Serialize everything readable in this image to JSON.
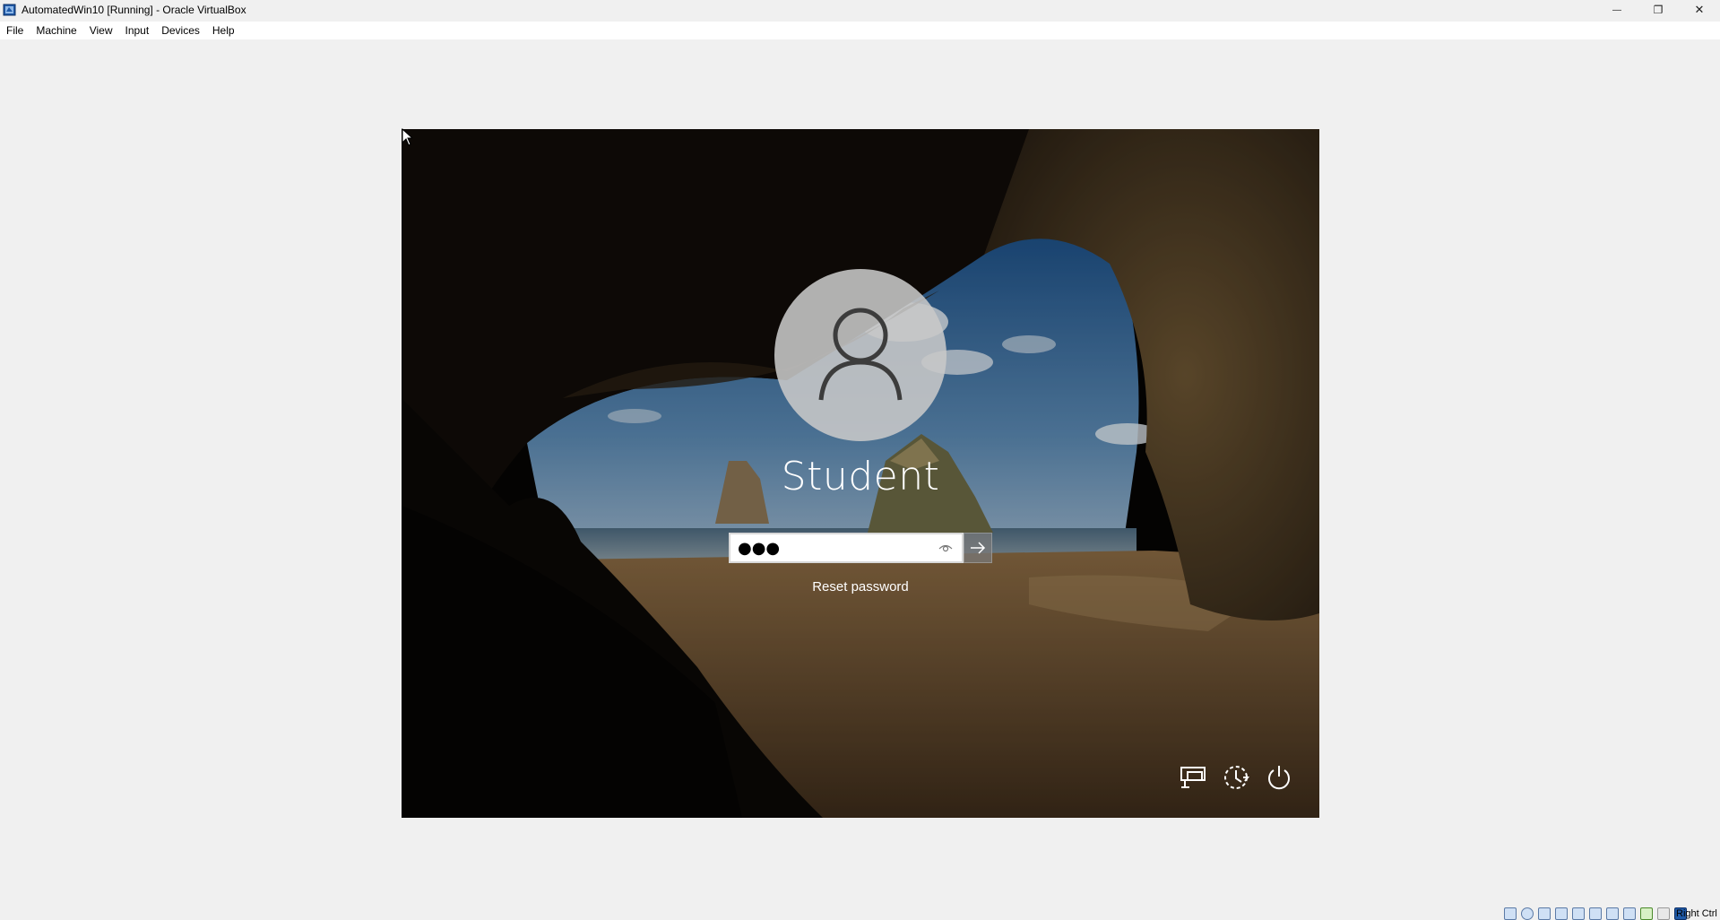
{
  "window": {
    "title": "AutomatedWin10 [Running] - Oracle VirtualBox",
    "controls": {
      "minimize": "—",
      "maximize": "❐",
      "close": "✕"
    }
  },
  "menu": {
    "items": [
      {
        "label": "File"
      },
      {
        "label": "Machine"
      },
      {
        "label": "View"
      },
      {
        "label": "Input"
      },
      {
        "label": "Devices"
      },
      {
        "label": "Help"
      }
    ]
  },
  "login": {
    "username": "Student",
    "password_value": "●●●",
    "reset_link": "Reset password"
  },
  "system_icons": [
    "network-icon",
    "accessibility-icon",
    "power-icon"
  ],
  "statusbar": {
    "host_key": "Right Ctrl",
    "icons": [
      "hard-disk-icon",
      "optical-drive-icon",
      "audio-icon",
      "network-adapter-icon",
      "usb-icon",
      "shared-folders-icon",
      "display-icon",
      "video-capture-icon",
      "cpu-icon",
      "mouse-integration-icon",
      "keyboard-icon"
    ]
  }
}
